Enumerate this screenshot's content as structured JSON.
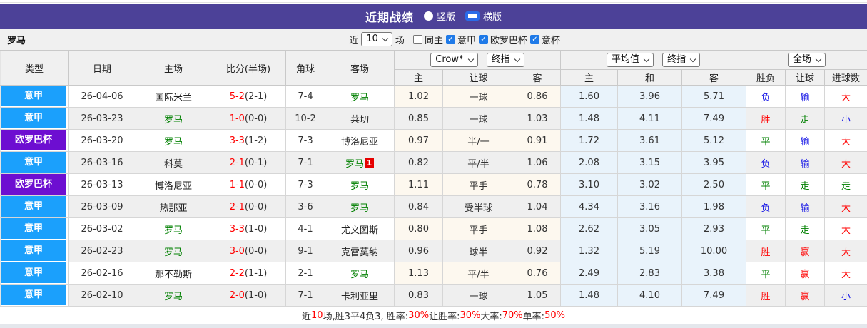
{
  "colors": {
    "topbar_bg": "#4C4198",
    "serie_a": "#1BA0FC",
    "europa": "#6D0ED1",
    "roma_green": "#008000",
    "score_red": "#FF0000",
    "result_red": "#FF0000",
    "result_green": "#008000",
    "result_blue": "#1414E6",
    "eu_cell_bg": "#E9F3FB",
    "checkbox_blue": "#1F7AE8"
  },
  "topbar": {
    "title": "近期战绩",
    "radios": [
      {
        "label": "竖版",
        "selected": false
      },
      {
        "label": "横版",
        "selected": true
      }
    ]
  },
  "filterbar": {
    "team": "罗马",
    "near_label": "近",
    "matches_value": "10",
    "matches_label": "场",
    "checkboxes": [
      {
        "label": "同主",
        "checked": false
      },
      {
        "label": "意甲",
        "checked": true
      },
      {
        "label": "欧罗巴杯",
        "checked": true
      },
      {
        "label": "意杯",
        "checked": true
      }
    ]
  },
  "table": {
    "headers": {
      "type": "类型",
      "date": "日期",
      "home": "主场",
      "score": "比分(半场)",
      "corner": "角球",
      "away": "客场",
      "ah_selects": [
        "Crow*",
        "终指"
      ],
      "eu_selects": [
        "平均值",
        "终指"
      ],
      "result_select": "全场",
      "sub": [
        "主",
        "让球",
        "客",
        "主",
        "和",
        "客",
        "胜负",
        "让球",
        "进球数"
      ]
    },
    "rows": [
      {
        "league": "意甲",
        "league_type": "serie_a",
        "date": "26-04-06",
        "home": "国际米兰",
        "home_is_roma": false,
        "home_red": 0,
        "score_ft": "5-2",
        "score_ht": "(2-1)",
        "corner": "7-4",
        "away": "罗马",
        "away_is_roma": true,
        "away_red": 0,
        "ah_home": "1.02",
        "ah_line": "一球",
        "ah_away": "0.86",
        "eu_home": "1.60",
        "eu_draw": "3.96",
        "eu_away": "5.71",
        "wdl": "负",
        "wdl_color": "blue",
        "handicap": "输",
        "handicap_color": "blue",
        "goals": "大",
        "goals_color": "red"
      },
      {
        "league": "意甲",
        "league_type": "serie_a",
        "date": "26-03-23",
        "home": "罗马",
        "home_is_roma": true,
        "home_red": 0,
        "score_ft": "1-0",
        "score_ht": "(0-0)",
        "corner": "10-2",
        "away": "莱切",
        "away_is_roma": false,
        "away_red": 0,
        "ah_home": "0.85",
        "ah_line": "一球",
        "ah_away": "1.03",
        "eu_home": "1.48",
        "eu_draw": "4.11",
        "eu_away": "7.49",
        "wdl": "胜",
        "wdl_color": "red",
        "handicap": "走",
        "handicap_color": "green",
        "goals": "小",
        "goals_color": "blue"
      },
      {
        "league": "欧罗巴杯",
        "league_type": "europa",
        "date": "26-03-20",
        "home": "罗马",
        "home_is_roma": true,
        "home_red": 0,
        "score_ft": "3-3",
        "score_ht": "(1-2)",
        "corner": "7-3",
        "away": "博洛尼亚",
        "away_is_roma": false,
        "away_red": 0,
        "ah_home": "0.97",
        "ah_line": "半/一",
        "ah_away": "0.91",
        "eu_home": "1.72",
        "eu_draw": "3.61",
        "eu_away": "5.12",
        "wdl": "平",
        "wdl_color": "green",
        "handicap": "输",
        "handicap_color": "blue",
        "goals": "大",
        "goals_color": "red"
      },
      {
        "league": "意甲",
        "league_type": "serie_a",
        "date": "26-03-16",
        "home": "科莫",
        "home_is_roma": false,
        "home_red": 0,
        "score_ft": "2-1",
        "score_ht": "(0-1)",
        "corner": "7-1",
        "away": "罗马",
        "away_is_roma": true,
        "away_red": 1,
        "ah_home": "0.82",
        "ah_line": "平/半",
        "ah_away": "1.06",
        "eu_home": "2.08",
        "eu_draw": "3.15",
        "eu_away": "3.95",
        "wdl": "负",
        "wdl_color": "blue",
        "handicap": "输",
        "handicap_color": "blue",
        "goals": "大",
        "goals_color": "red"
      },
      {
        "league": "欧罗巴杯",
        "league_type": "europa",
        "date": "26-03-13",
        "home": "博洛尼亚",
        "home_is_roma": false,
        "home_red": 0,
        "score_ft": "1-1",
        "score_ht": "(0-0)",
        "corner": "7-3",
        "away": "罗马",
        "away_is_roma": true,
        "away_red": 0,
        "ah_home": "1.11",
        "ah_line": "平手",
        "ah_away": "0.78",
        "eu_home": "3.10",
        "eu_draw": "3.02",
        "eu_away": "2.50",
        "wdl": "平",
        "wdl_color": "green",
        "handicap": "走",
        "handicap_color": "green",
        "goals": "走",
        "goals_color": "green"
      },
      {
        "league": "意甲",
        "league_type": "serie_a",
        "date": "26-03-09",
        "home": "热那亚",
        "home_is_roma": false,
        "home_red": 0,
        "score_ft": "2-1",
        "score_ht": "(0-0)",
        "corner": "3-6",
        "away": "罗马",
        "away_is_roma": true,
        "away_red": 0,
        "ah_home": "0.84",
        "ah_line": "受半球",
        "ah_away": "1.04",
        "eu_home": "4.34",
        "eu_draw": "3.16",
        "eu_away": "1.98",
        "wdl": "负",
        "wdl_color": "blue",
        "handicap": "输",
        "handicap_color": "blue",
        "goals": "大",
        "goals_color": "red"
      },
      {
        "league": "意甲",
        "league_type": "serie_a",
        "date": "26-03-02",
        "home": "罗马",
        "home_is_roma": true,
        "home_red": 0,
        "score_ft": "3-3",
        "score_ht": "(1-0)",
        "corner": "4-1",
        "away": "尤文图斯",
        "away_is_roma": false,
        "away_red": 0,
        "ah_home": "0.80",
        "ah_line": "平手",
        "ah_away": "1.08",
        "eu_home": "2.62",
        "eu_draw": "3.05",
        "eu_away": "2.93",
        "wdl": "平",
        "wdl_color": "green",
        "handicap": "走",
        "handicap_color": "green",
        "goals": "大",
        "goals_color": "red"
      },
      {
        "league": "意甲",
        "league_type": "serie_a",
        "date": "26-02-23",
        "home": "罗马",
        "home_is_roma": true,
        "home_red": 0,
        "score_ft": "3-0",
        "score_ht": "(0-0)",
        "corner": "9-1",
        "away": "克雷莫纳",
        "away_is_roma": false,
        "away_red": 0,
        "ah_home": "0.96",
        "ah_line": "球半",
        "ah_away": "0.92",
        "eu_home": "1.32",
        "eu_draw": "5.19",
        "eu_away": "10.00",
        "wdl": "胜",
        "wdl_color": "red",
        "handicap": "赢",
        "handicap_color": "red",
        "goals": "大",
        "goals_color": "red"
      },
      {
        "league": "意甲",
        "league_type": "serie_a",
        "date": "26-02-16",
        "home": "那不勒斯",
        "home_is_roma": false,
        "home_red": 0,
        "score_ft": "2-2",
        "score_ht": "(1-1)",
        "corner": "2-1",
        "away": "罗马",
        "away_is_roma": true,
        "away_red": 0,
        "ah_home": "1.13",
        "ah_line": "平/半",
        "ah_away": "0.76",
        "eu_home": "2.49",
        "eu_draw": "2.83",
        "eu_away": "3.38",
        "wdl": "平",
        "wdl_color": "green",
        "handicap": "赢",
        "handicap_color": "red",
        "goals": "大",
        "goals_color": "red"
      },
      {
        "league": "意甲",
        "league_type": "serie_a",
        "date": "26-02-10",
        "home": "罗马",
        "home_is_roma": true,
        "home_red": 0,
        "score_ft": "2-0",
        "score_ht": "(1-0)",
        "corner": "7-1",
        "away": "卡利亚里",
        "away_is_roma": false,
        "away_red": 0,
        "ah_home": "0.83",
        "ah_line": "一球",
        "ah_away": "1.05",
        "eu_home": "1.48",
        "eu_draw": "4.10",
        "eu_away": "7.49",
        "wdl": "胜",
        "wdl_color": "red",
        "handicap": "赢",
        "handicap_color": "red",
        "goals": "小",
        "goals_color": "blue"
      }
    ]
  },
  "footer": {
    "segments": [
      {
        "text": "近",
        "red": false
      },
      {
        "text": "10",
        "red": true
      },
      {
        "text": "场,胜3平4负3, 胜率:",
        "red": false
      },
      {
        "text": "30%",
        "red": true
      },
      {
        "text": " 让胜率:",
        "red": false
      },
      {
        "text": "30%",
        "red": true
      },
      {
        "text": " 大率:",
        "red": false
      },
      {
        "text": "70%",
        "red": true
      },
      {
        "text": " 单率:",
        "red": false
      },
      {
        "text": "50%",
        "red": true
      }
    ]
  }
}
